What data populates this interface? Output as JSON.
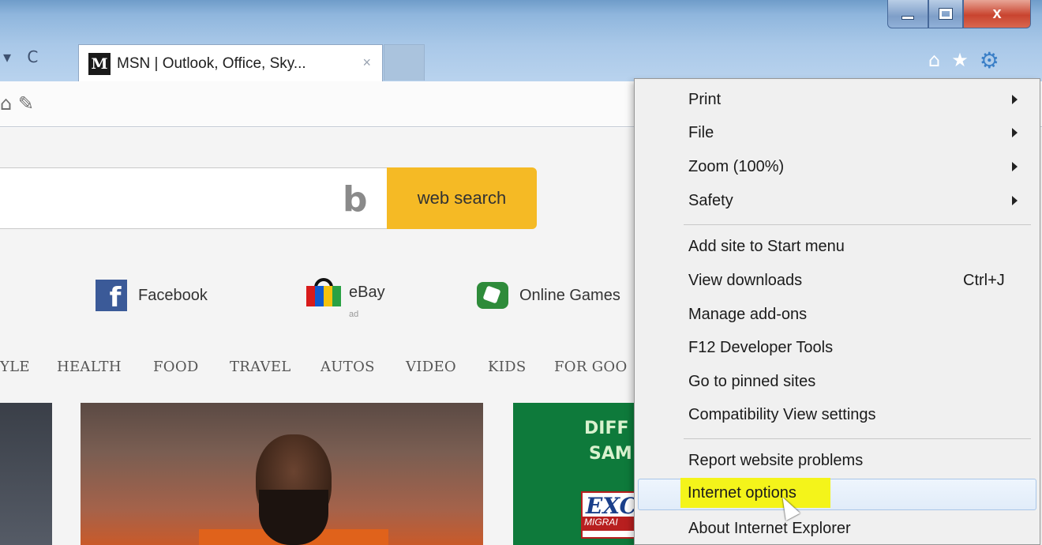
{
  "window": {
    "minimize_icon": "minimize-icon",
    "maximize_icon": "maximize-icon",
    "close_label": "x"
  },
  "nav": {
    "search_dropdown": "▾",
    "refresh_glyph": "C"
  },
  "tab": {
    "favicon_text": "M",
    "title": "MSN | Outlook, Office, Sky...",
    "close_glyph": "×"
  },
  "toolbar_right": {
    "home_glyph": "⌂",
    "favorites_glyph": "★",
    "tools_glyph": "⚙"
  },
  "command_bar": {
    "icons_glyph": "⌂ ✎"
  },
  "search": {
    "input_value": "",
    "bing_glyph": "b",
    "button_label": "web search"
  },
  "quick_links": [
    {
      "label": "Facebook",
      "icon": "facebook-icon"
    },
    {
      "label": "eBay",
      "icon": "ebay-icon",
      "sub": "ad"
    },
    {
      "label": "Online Games",
      "icon": "games-icon"
    }
  ],
  "categories": [
    "YLE",
    "HEALTH",
    "FOOD",
    "TRAVEL",
    "AUTOS",
    "VIDEO",
    "KIDS",
    "FOR GOO"
  ],
  "ad": {
    "line1": "DIFF",
    "line2": "SAM",
    "logo": "EXC",
    "logo_sub": "MIGRAI"
  },
  "tools_menu": {
    "items": [
      {
        "label": "Print",
        "submenu": true
      },
      {
        "label": "File",
        "submenu": true
      },
      {
        "label": "Zoom (100%)",
        "submenu": true
      },
      {
        "label": "Safety",
        "submenu": true
      },
      {
        "label": "Add site to Start menu"
      },
      {
        "label": "View downloads",
        "shortcut": "Ctrl+J"
      },
      {
        "label": "Manage add-ons"
      },
      {
        "label": "F12 Developer Tools"
      },
      {
        "label": "Go to pinned sites"
      },
      {
        "label": "Compatibility View settings"
      },
      {
        "label": "Report website problems"
      },
      {
        "label": "Internet options",
        "highlighted": true
      },
      {
        "label": "About Internet Explorer"
      }
    ]
  },
  "colors": {
    "search_button": "#f5ba25",
    "highlight": "#f4f41a",
    "facebook": "#3b5a98",
    "gear": "#3a7fc7"
  }
}
